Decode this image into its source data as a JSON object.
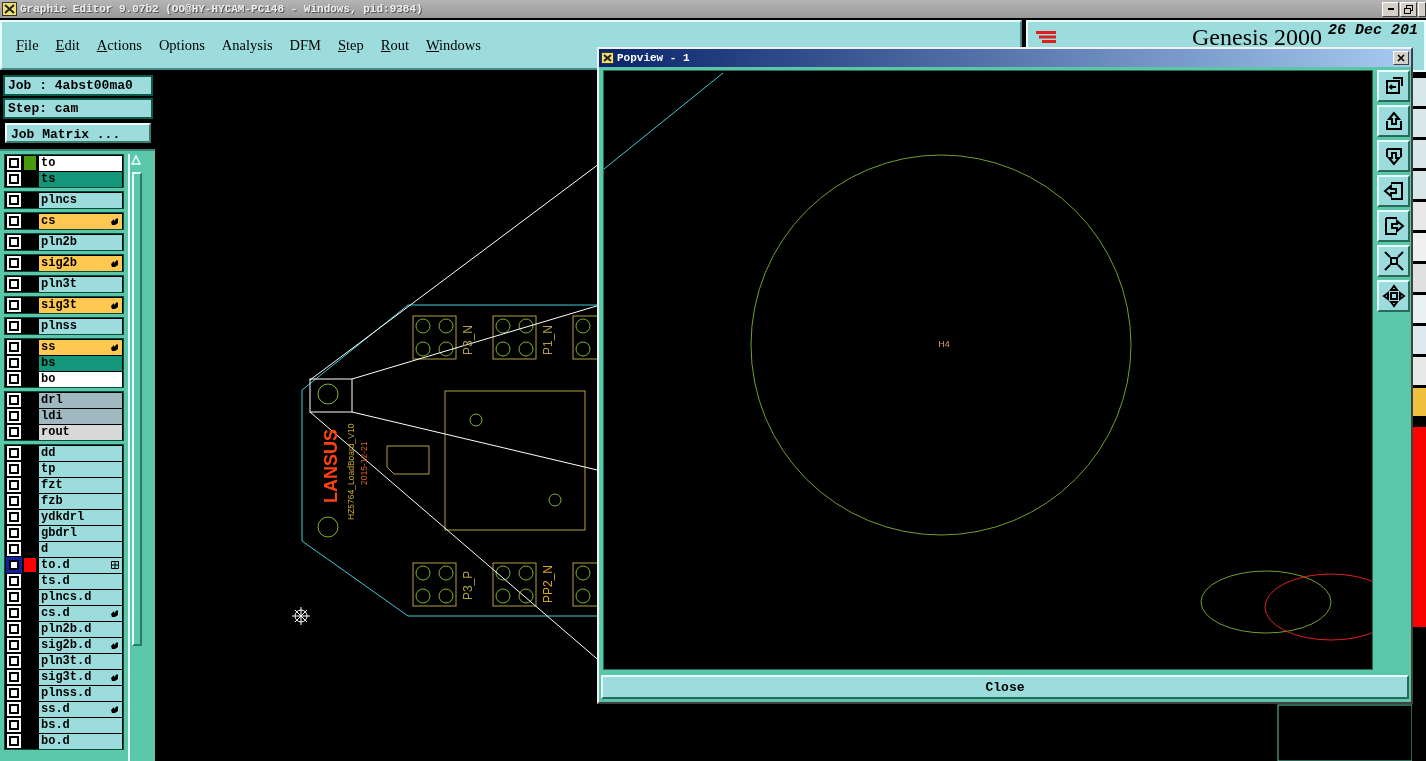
{
  "window": {
    "title": "Graphic Editor 9.07b2 (OO@HY-HYCAM-PC148 - Windows, pid:9384)"
  },
  "menu": [
    {
      "label": "File",
      "underline_first": true
    },
    {
      "label": "Edit",
      "underline_first": true
    },
    {
      "label": "Actions",
      "underline_first": true
    },
    {
      "label": "Options",
      "underline_first": false
    },
    {
      "label": "Analysis",
      "underline_first": false
    },
    {
      "label": "DFM",
      "underline_first": false
    },
    {
      "label": "Step",
      "underline_first": true
    },
    {
      "label": "Rout",
      "underline_first": true
    },
    {
      "label": "Windows",
      "underline_first": true
    }
  ],
  "header": {
    "product": "Genesis 2000",
    "date": "26 Dec 201"
  },
  "job": "Job : 4abst00ma0",
  "step": "Step: cam",
  "job_matrix_button": "Job Matrix ...",
  "layer_groups": [
    {
      "layers": [
        {
          "name": "to",
          "kind": "silk",
          "color": "#4a9a10",
          "marked": false,
          "checked": true,
          "affected": false
        },
        {
          "name": "ts",
          "kind": "mask",
          "marked": false,
          "checked": true,
          "affected": false
        }
      ]
    },
    {
      "layers": [
        {
          "name": "plncs",
          "kind": "plane",
          "marked": false,
          "checked": true,
          "affected": false
        }
      ]
    },
    {
      "layers": [
        {
          "name": "cs",
          "kind": "signal",
          "marked": true,
          "checked": true,
          "affected": false
        }
      ]
    },
    {
      "layers": [
        {
          "name": "pln2b",
          "kind": "plane",
          "marked": false,
          "checked": true,
          "affected": false
        }
      ]
    },
    {
      "layers": [
        {
          "name": "sig2b",
          "kind": "signal",
          "marked": true,
          "checked": true,
          "affected": false
        }
      ]
    },
    {
      "layers": [
        {
          "name": "pln3t",
          "kind": "plane",
          "marked": false,
          "checked": true,
          "affected": false
        }
      ]
    },
    {
      "layers": [
        {
          "name": "sig3t",
          "kind": "signal",
          "marked": true,
          "checked": true,
          "affected": false
        }
      ]
    },
    {
      "layers": [
        {
          "name": "plnss",
          "kind": "plane",
          "marked": false,
          "checked": true,
          "affected": false
        }
      ]
    },
    {
      "layers": [
        {
          "name": "ss",
          "kind": "signal",
          "marked": true,
          "checked": true,
          "affected": false
        },
        {
          "name": "bs",
          "kind": "mask",
          "marked": false,
          "checked": true,
          "affected": false
        },
        {
          "name": "bo",
          "kind": "silk",
          "marked": false,
          "checked": true,
          "affected": false
        }
      ]
    },
    {
      "layers": [
        {
          "name": "drl",
          "kind": "drill",
          "marked": false,
          "checked": true,
          "affected": false
        },
        {
          "name": "ldi",
          "kind": "drill",
          "marked": false,
          "checked": true,
          "affected": false
        },
        {
          "name": "rout",
          "kind": "rout",
          "marked": false,
          "checked": true,
          "affected": false
        }
      ]
    },
    {
      "layers": [
        {
          "name": "dd",
          "kind": "document",
          "marked": false,
          "checked": true,
          "affected": false
        },
        {
          "name": "tp",
          "kind": "document",
          "marked": false,
          "checked": true,
          "affected": false
        },
        {
          "name": "fzt",
          "kind": "document",
          "marked": false,
          "checked": true,
          "affected": false
        },
        {
          "name": "fzb",
          "kind": "document",
          "marked": false,
          "checked": true,
          "affected": false
        },
        {
          "name": "ydkdrl",
          "kind": "document",
          "marked": false,
          "checked": true,
          "affected": false
        },
        {
          "name": "gbdrl",
          "kind": "document",
          "marked": false,
          "checked": true,
          "affected": false
        },
        {
          "name": "d",
          "kind": "document",
          "marked": false,
          "checked": true,
          "affected": false
        },
        {
          "name": "to.d",
          "kind": "document",
          "color": "#ff0000",
          "marked": false,
          "checked": true,
          "affected": true
        },
        {
          "name": "ts.d",
          "kind": "document",
          "marked": false,
          "checked": true,
          "affected": false
        },
        {
          "name": "plncs.d",
          "kind": "document",
          "marked": false,
          "checked": true,
          "affected": false
        },
        {
          "name": "cs.d",
          "kind": "document",
          "marked": true,
          "checked": true,
          "affected": false
        },
        {
          "name": "pln2b.d",
          "kind": "document",
          "marked": false,
          "checked": true,
          "affected": false
        },
        {
          "name": "sig2b.d",
          "kind": "document",
          "marked": true,
          "checked": true,
          "affected": false
        },
        {
          "name": "pln3t.d",
          "kind": "document",
          "marked": false,
          "checked": true,
          "affected": false
        },
        {
          "name": "sig3t.d",
          "kind": "document",
          "marked": true,
          "checked": true,
          "affected": false
        },
        {
          "name": "plnss.d",
          "kind": "document",
          "marked": false,
          "checked": true,
          "affected": false
        },
        {
          "name": "ss.d",
          "kind": "document",
          "marked": true,
          "checked": true,
          "affected": false
        },
        {
          "name": "bs.d",
          "kind": "document",
          "marked": false,
          "checked": true,
          "affected": false
        },
        {
          "name": "bo.d",
          "kind": "document",
          "marked": false,
          "checked": true,
          "affected": false
        }
      ]
    }
  ],
  "canvas": {
    "pad_labels": [
      "P3_N",
      "P1_N",
      "P3_P",
      "PP2_N"
    ],
    "logo_text": "LANSUS",
    "board_name": "HZ5764_LoadBoard_V10",
    "board_date": "2015-12-21"
  },
  "popview": {
    "title": "Popview - 1",
    "feature_label": "H4",
    "close_button": "Close"
  }
}
